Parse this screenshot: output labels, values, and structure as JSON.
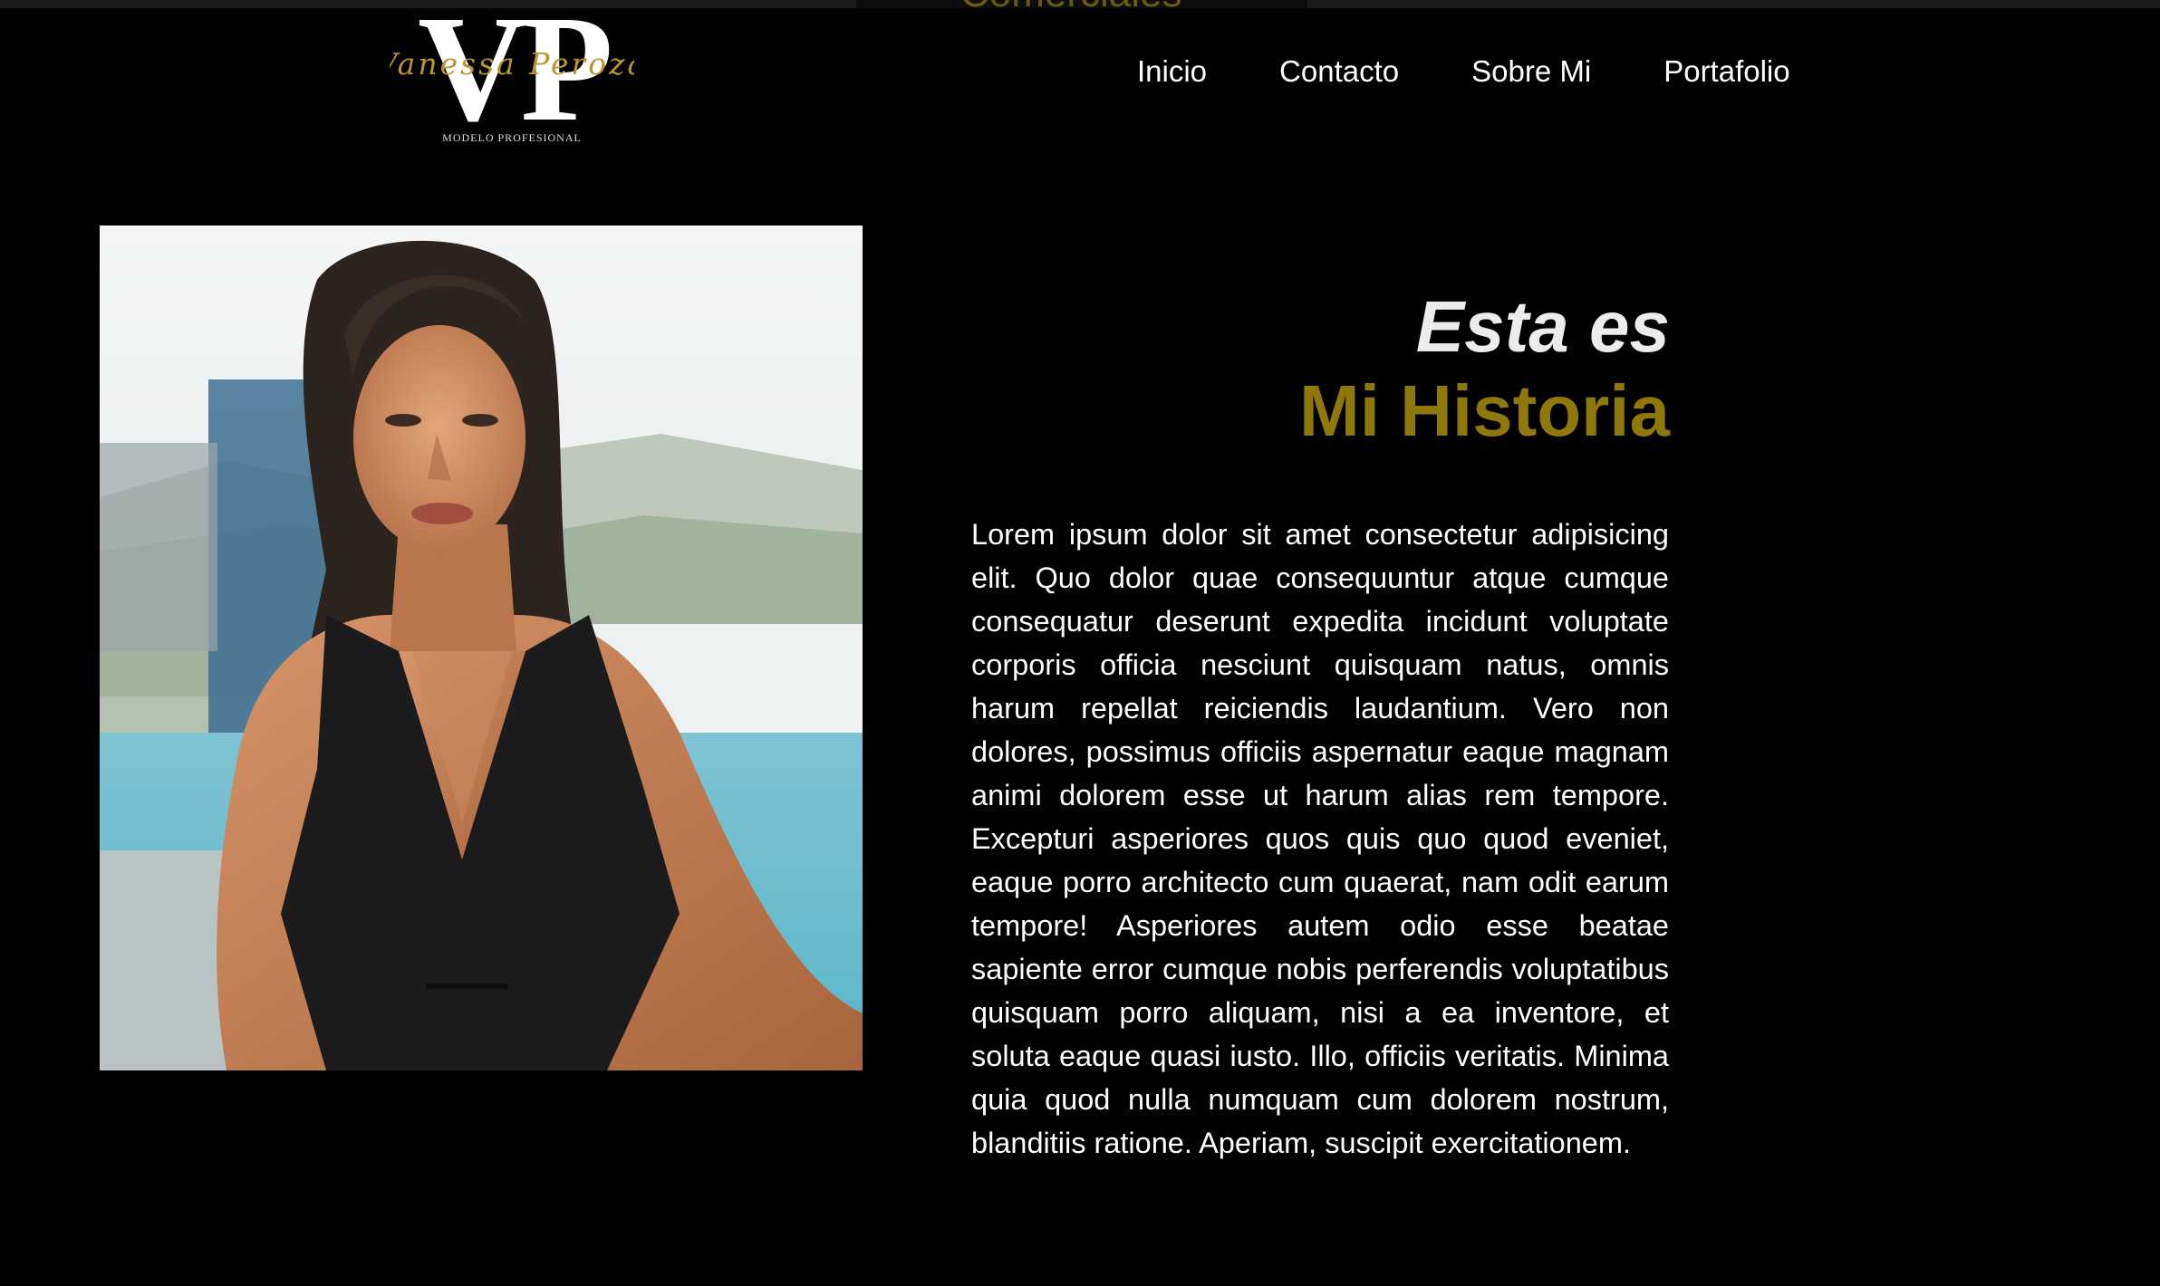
{
  "header": {
    "logo": {
      "monogram": "VP",
      "name": "Vanessa Peroza",
      "tagline": "MODELO PROFESIONAL"
    },
    "nav": [
      {
        "label": "Inicio"
      },
      {
        "label": "Contacto"
      },
      {
        "label": "Sobre Mi"
      },
      {
        "label": "Portafolio"
      }
    ],
    "previous_section_fragment": "Comerciales"
  },
  "about": {
    "heading_line1": "Esta es",
    "heading_line2": "Mi Historia",
    "body": "Lorem ipsum dolor sit amet consectetur adipisicing elit. Quo dolor quae consequuntur atque cumque consequatur deserunt expedita incidunt voluptate corporis officia nesciunt quisquam natus, omnis harum repellat reiciendis laudantium. Vero non dolores, possimus officiis aspernatur eaque magnam animi dolorem esse ut harum alias rem tempore. Excepturi asperiores quos quis quo quod eveniet, eaque porro architecto cum quaerat, nam odit earum tempore! Asperiores autem odio esse beatae sapiente error cumque nobis perferendis voluptatibus quisquam porro aliquam, nisi a ea inventore, et soluta eaque quasi iusto. Illo, officiis veritatis. Minima quia quod nulla numquam cum dolorem nostrum, blanditiis ratione. Aperiam, suscipit exercitationem."
  },
  "colors": {
    "background": "#000000",
    "accent_gold": "#8e780a",
    "heading_light": "#ececec",
    "text": "#ffffff"
  }
}
